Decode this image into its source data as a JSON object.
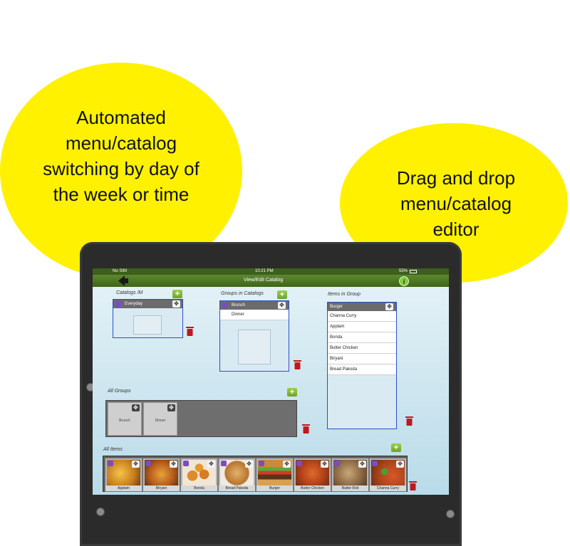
{
  "callouts": {
    "left": "Automated menu/catalog switching by day of the week or time",
    "right": "Drag and drop menu/catalog editor"
  },
  "status_bar": {
    "carrier": "No SIM",
    "time": "10:21 PM",
    "battery": "55%"
  },
  "nav": {
    "title": "View/Edit Catalog",
    "back_icon": "back-arrow-icon",
    "info_icon": "info-icon"
  },
  "catalogs": {
    "label": "Catalogs /M",
    "selected": "Everyday"
  },
  "groups_in_catalogs": {
    "label": "Groups in Catalogs",
    "items": [
      "Brunch",
      "Dinner"
    ]
  },
  "items_in_group": {
    "label": "Items in Group",
    "header": "Burger",
    "items": [
      "Channa Curry",
      "Applam",
      "Bonda",
      "Butter Chicken",
      "Biryani",
      "Bread Pakoda"
    ]
  },
  "all_groups": {
    "label": "All Groups",
    "tiles": [
      "Brunch",
      "Dinner"
    ]
  },
  "all_items": {
    "label": "All Items",
    "tiles": [
      "Applam",
      "Biryani",
      "Bonda",
      "Bread Pakoda",
      "Burger",
      "Butter Chicken",
      "Butter Roti",
      "Channa Curry"
    ]
  },
  "colors": {
    "callout": "#fff100",
    "navbar": "#4e7a24",
    "panel_border": "#2a50c8",
    "add_button": "#7fb534",
    "trash": "#c0181e"
  }
}
